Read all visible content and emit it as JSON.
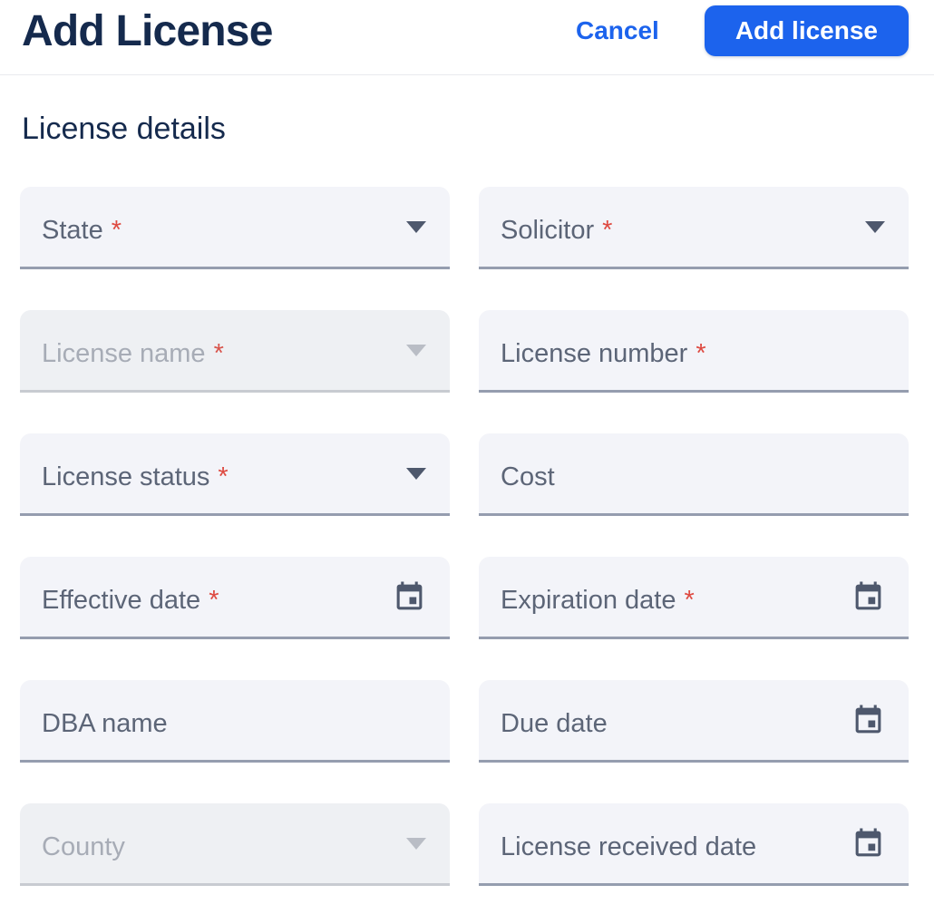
{
  "header": {
    "title": "Add License",
    "cancel_label": "Cancel",
    "submit_label": "Add license"
  },
  "section": {
    "title": "License details"
  },
  "form": {
    "required_marker": "*",
    "fields": [
      {
        "label": "State",
        "type": "select",
        "required": true,
        "disabled": false,
        "value": "",
        "icon": "chevron-down-icon"
      },
      {
        "label": "Solicitor",
        "type": "select",
        "required": true,
        "disabled": false,
        "value": "",
        "icon": "chevron-down-icon"
      },
      {
        "label": "License name",
        "type": "select",
        "required": true,
        "disabled": true,
        "value": "",
        "icon": "chevron-down-icon"
      },
      {
        "label": "License number",
        "type": "text",
        "required": true,
        "disabled": false,
        "value": "",
        "icon": "none"
      },
      {
        "label": "License status",
        "type": "select",
        "required": true,
        "disabled": false,
        "value": "",
        "icon": "chevron-down-icon"
      },
      {
        "label": "Cost",
        "type": "text",
        "required": false,
        "disabled": false,
        "value": "",
        "icon": "none"
      },
      {
        "label": "Effective date",
        "type": "date",
        "required": true,
        "disabled": false,
        "value": "",
        "icon": "calendar-icon"
      },
      {
        "label": "Expiration date",
        "type": "date",
        "required": true,
        "disabled": false,
        "value": "",
        "icon": "calendar-icon"
      },
      {
        "label": "DBA name",
        "type": "text",
        "required": false,
        "disabled": false,
        "value": "",
        "icon": "none"
      },
      {
        "label": "Due date",
        "type": "date",
        "required": false,
        "disabled": false,
        "value": "",
        "icon": "calendar-icon"
      },
      {
        "label": "County",
        "type": "select",
        "required": false,
        "disabled": true,
        "value": "",
        "icon": "chevron-down-icon"
      },
      {
        "label": "License received date",
        "type": "date",
        "required": false,
        "disabled": false,
        "value": "",
        "icon": "calendar-icon"
      }
    ]
  },
  "colors": {
    "accent_blue": "#1c63ed",
    "title_navy": "#152a4d",
    "required_red": "#de4a41",
    "field_background": "#f3f4f9",
    "field_background_disabled": "#eef0f3",
    "field_underline": "#959daf",
    "label_gray": "#5c6577",
    "icon_slate": "#4e586d"
  }
}
